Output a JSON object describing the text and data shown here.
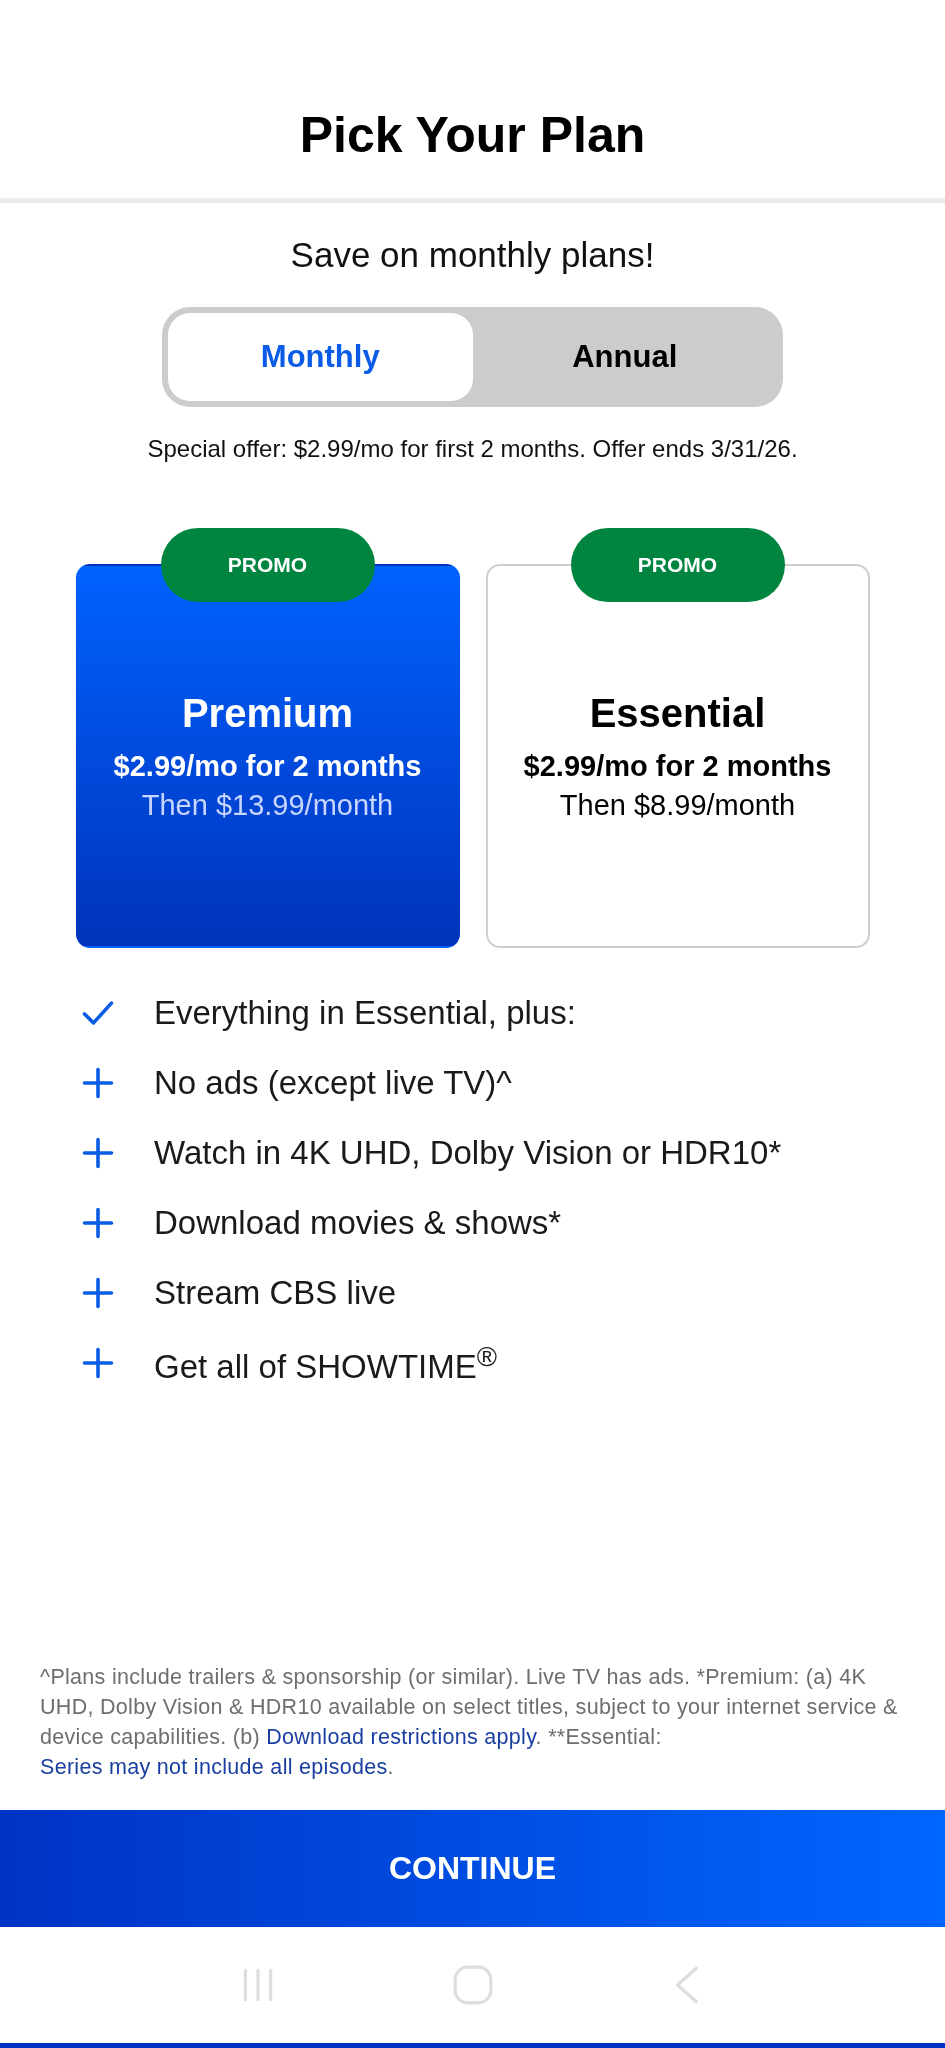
{
  "header": {
    "title": "Pick Your Plan"
  },
  "subtitle": "Save on monthly plans!",
  "billing_tabs": [
    {
      "label": "Monthly",
      "selected": true
    },
    {
      "label": "Annual",
      "selected": false
    }
  ],
  "offer_text": "Special offer: $2.99/mo for first 2 months. Offer ends 3/31/26.",
  "plans": [
    {
      "badge": "PROMO",
      "name": "Premium",
      "promo_price": "$2.99/mo for 2 months",
      "then_price": "Then $13.99/month",
      "selected": true
    },
    {
      "badge": "PROMO",
      "name": "Essential",
      "promo_price": "$2.99/mo for 2 months",
      "then_price": "Then $8.99/month",
      "selected": false
    }
  ],
  "features": [
    {
      "kind": "check",
      "text": "Everything in Essential, plus:"
    },
    {
      "kind": "plus",
      "text": "No ads (except live TV)^"
    },
    {
      "kind": "plus",
      "text": "Watch in 4K UHD, Dolby Vision or HDR10*"
    },
    {
      "kind": "plus",
      "text": "Download movies & shows*"
    },
    {
      "kind": "plus",
      "text": "Stream CBS live"
    },
    {
      "kind": "plus",
      "text": "Get all of SHOWTIME$^{®}$"
    }
  ],
  "footnote": [
    {
      "kind": "text",
      "text": "^Plans include trailers & sponsorship (or similar). Live TV has ads. *Premium: (a) 4K UHD, Dolby Vision & HDR10 available on select titles, subject to your internet service & device capabilities. (b) "
    },
    {
      "kind": "link",
      "text": "Download restrictions apply"
    },
    {
      "kind": "text",
      "text": ". **Essential: "
    },
    {
      "kind": "link",
      "text": "Series may not include all episodes"
    },
    {
      "kind": "text",
      "text": "."
    }
  ],
  "continue_button": "CONTINUE"
}
